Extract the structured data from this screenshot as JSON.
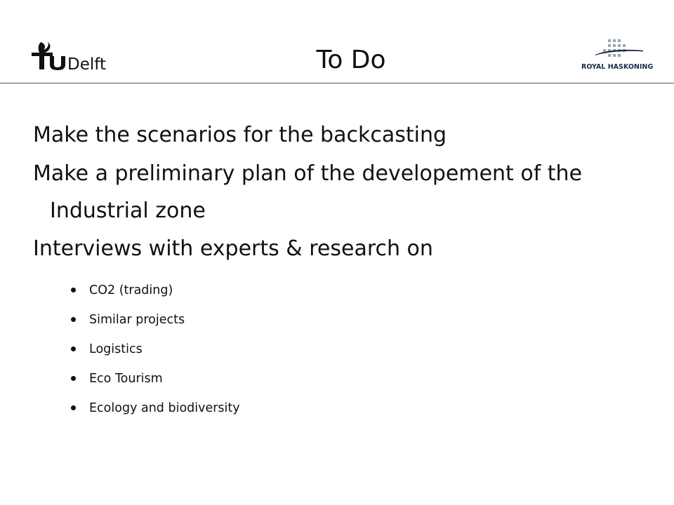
{
  "slide": {
    "title": "To Do",
    "logos": {
      "left_text": "TUDelft",
      "right_text": "ROYAL HASKONING"
    },
    "main_points": [
      "Make the scenarios for the backcasting",
      "Make a preliminary plan of the developement of the Industrial zone",
      "Interviews with experts & research on"
    ],
    "sub_points": [
      "CO2 (trading)",
      "Similar projects",
      "Logistics",
      "Eco Tourism",
      "Ecology and biodiversity"
    ]
  },
  "colors": {
    "background": "#ffffff",
    "text": "#111111",
    "rule": "#555555",
    "haskoning_grid": "#9aa4b0",
    "haskoning_text": "#1c2a4a"
  }
}
